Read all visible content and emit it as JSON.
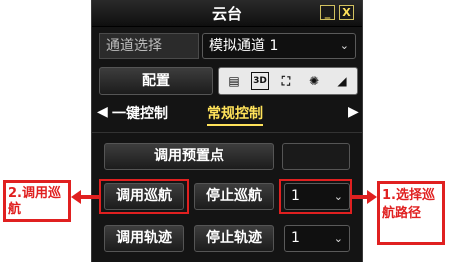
{
  "window": {
    "title": "云台",
    "minimize": "_",
    "close": "X"
  },
  "channel": {
    "label": "通道选择",
    "value": "模拟通道 1"
  },
  "config": {
    "label": "配置",
    "icons": [
      "list-icon",
      "3d-icon",
      "fullscreen-icon",
      "light-icon",
      "wiper-icon"
    ],
    "icon_3d_text": "3D"
  },
  "tabs": {
    "prev": "◀",
    "next": "▶",
    "items": [
      "一键控制",
      "常规控制"
    ],
    "active": 1
  },
  "controls": {
    "call_preset": "调用预置点",
    "call_cruise": "调用巡航",
    "stop_cruise": "停止巡航",
    "cruise_value": "1",
    "call_track": "调用轨迹",
    "stop_track": "停止轨迹",
    "track_value": "1"
  },
  "annotations": {
    "left": "2.调用巡航",
    "right": "1.选择巡航路径",
    "color": "#e02020"
  }
}
